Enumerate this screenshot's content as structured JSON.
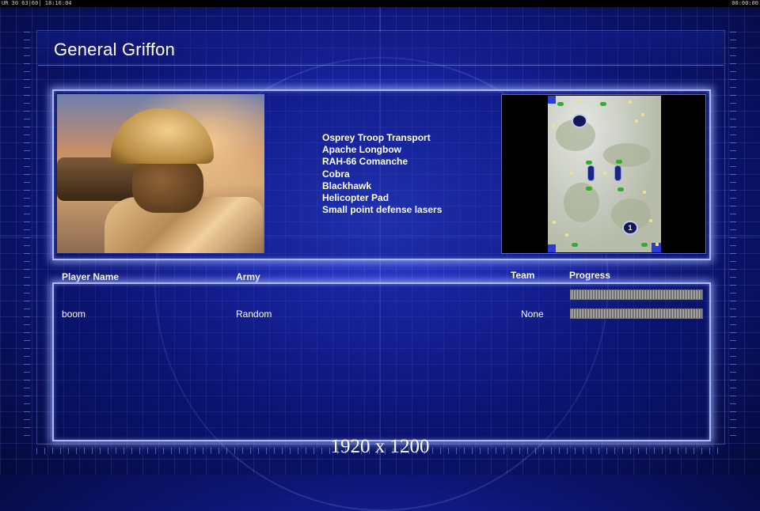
{
  "status_bar": {
    "left": "UR 30 63|60| 18:16:04",
    "right": "00:00:00"
  },
  "general": {
    "title": "General Griffon"
  },
  "units": [
    "Osprey Troop Transport",
    "Apache Longbow",
    "RAH-66 Comanche",
    "Cobra",
    "Blackhawk",
    "Helicopter Pad",
    "Small point defense lasers"
  ],
  "minimap": {
    "start_position_label": "1"
  },
  "players_table": {
    "headers": {
      "player_name": "Player Name",
      "army": "Army",
      "team": "Team",
      "progress": "Progress"
    },
    "rows": [
      {
        "player_name": "",
        "army": "",
        "team": "",
        "faded": true
      },
      {
        "player_name": "boom",
        "army": "Random",
        "team": "None",
        "faded": false
      }
    ]
  },
  "resolution_label": "1920 x 1200",
  "colors": {
    "background": "#1a26a8",
    "panel_glow": "#aab8ff",
    "text": "#ffffff"
  }
}
